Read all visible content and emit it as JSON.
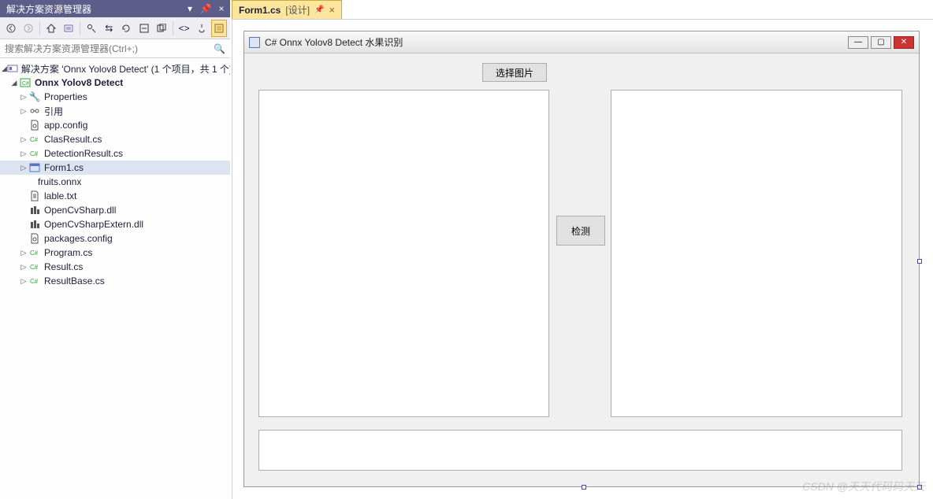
{
  "panel": {
    "title": "解决方案资源管理器",
    "search_placeholder": "搜索解决方案资源管理器(Ctrl+;)"
  },
  "tree": {
    "solution": "解决方案 'Onnx Yolov8 Detect' (1 个项目，共 1 个)",
    "project": "Onnx Yolov8 Detect",
    "items": [
      "Properties",
      "引用",
      "app.config",
      "ClasResult.cs",
      "DetectionResult.cs",
      "Form1.cs",
      "fruits.onnx",
      "lable.txt",
      "OpenCvSharp.dll",
      "OpenCvSharpExtern.dll",
      "packages.config",
      "Program.cs",
      "Result.cs",
      "ResultBase.cs"
    ]
  },
  "tab": {
    "file": "Form1.cs",
    "mode": "[设计]"
  },
  "form": {
    "title": "C# Onnx Yolov8 Detect 水果识别",
    "select_button": "选择图片",
    "detect_button": "检测"
  },
  "watermark": "CSDN @天天代码码天天"
}
